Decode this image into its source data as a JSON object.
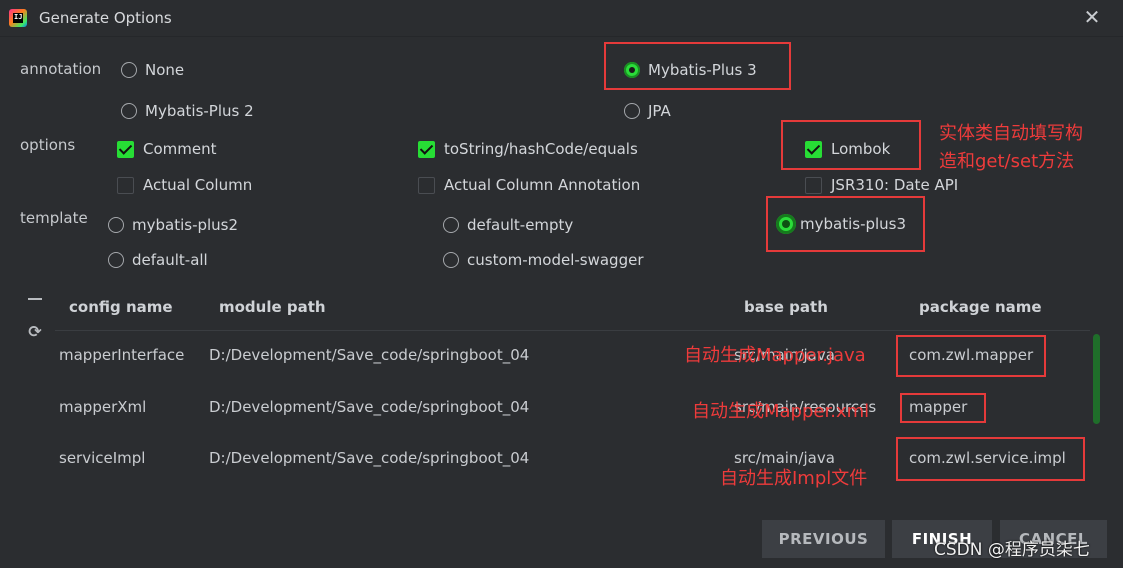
{
  "window": {
    "title": "Generate Options"
  },
  "annotation": {
    "label": "annotation",
    "options": [
      "None",
      "Mybatis-Plus 3",
      "Mybatis-Plus 2",
      "JPA"
    ],
    "selected": "Mybatis-Plus 3"
  },
  "options": {
    "label": "options",
    "items": [
      {
        "label": "Comment",
        "checked": true
      },
      {
        "label": "toString/hashCode/equals",
        "checked": true
      },
      {
        "label": "Lombok",
        "checked": true
      },
      {
        "label": "Actual Column",
        "checked": false
      },
      {
        "label": "Actual Column Annotation",
        "checked": false
      },
      {
        "label": "JSR310: Date API",
        "checked": false
      }
    ]
  },
  "template": {
    "label": "template",
    "options": [
      "mybatis-plus2",
      "default-empty",
      "mybatis-plus3",
      "default-all",
      "custom-model-swagger"
    ],
    "selected": "mybatis-plus3"
  },
  "table": {
    "columns": [
      "config name",
      "module path",
      "base path",
      "package name"
    ],
    "rows": [
      {
        "config": "mapperInterface",
        "module": "D:/Development/Save_code/springboot_04",
        "base": "src/main/java",
        "package": "com.zwl.mapper"
      },
      {
        "config": "mapperXml",
        "module": "D:/Development/Save_code/springboot_04",
        "base": "src/main/resources",
        "package": "mapper"
      },
      {
        "config": "serviceImpl",
        "module": "D:/Development/Save_code/springboot_04",
        "base": "src/main/java",
        "package": "com.zwl.service.impl"
      }
    ]
  },
  "annotations": {
    "lombok_note_line1": "实体类自动填写构",
    "lombok_note_line2": "造和get/set方法",
    "mapper_note": "自动生成Mapper.java",
    "xml_note": "自动生成Mapper.xml",
    "impl_note": "自动生成Impl文件"
  },
  "buttons": {
    "previous": "PREVIOUS",
    "finish": "FINISH",
    "cancel": "CANCEL"
  },
  "watermark": "CSDN @程序员柒七",
  "colors": {
    "background": "#2b2d30",
    "accent_green": "#27dd35",
    "annotation_red": "#e53a3a"
  }
}
